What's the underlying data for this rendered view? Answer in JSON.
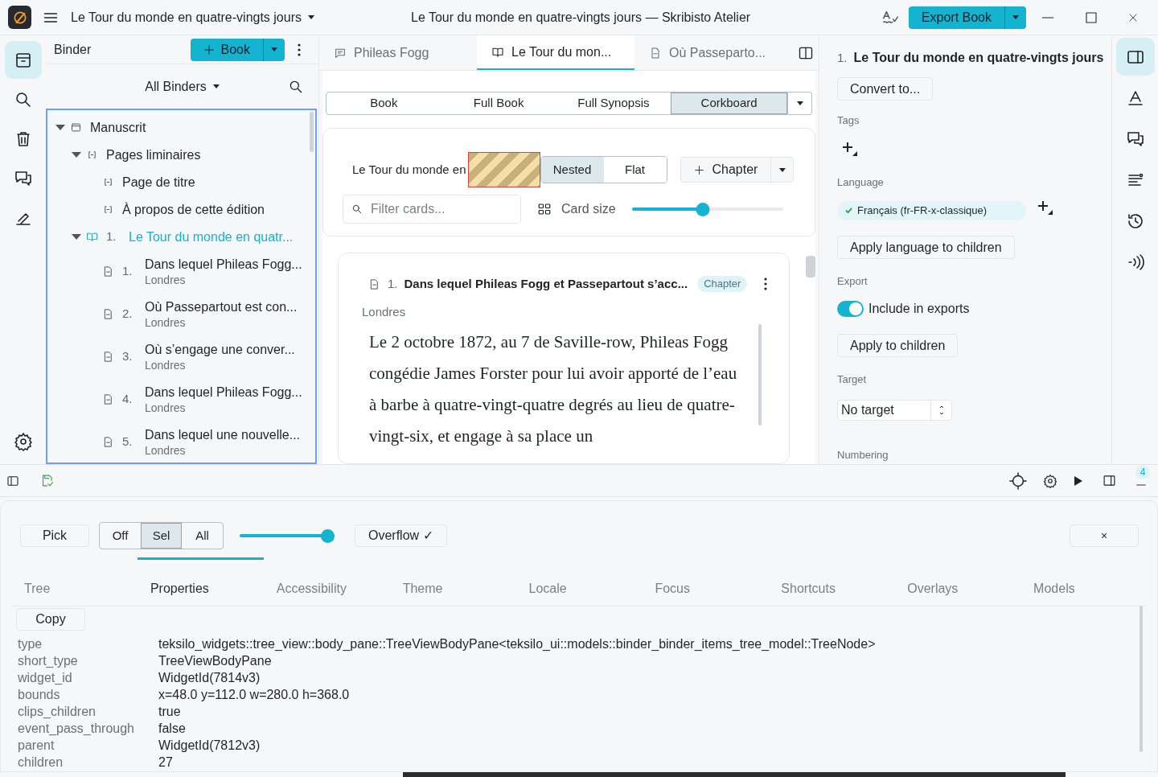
{
  "window": {
    "title": "Le Tour du monde en quatre-vingts jours — Skribisto Atelier"
  },
  "project_menu": {
    "label": "Le Tour du monde en quatre-vingts jours"
  },
  "export_button": {
    "label": "Export Book"
  },
  "left_rail": [
    {
      "kind": "binder",
      "selected": true
    },
    {
      "kind": "search",
      "selected": false
    },
    {
      "kind": "trash",
      "selected": false
    },
    {
      "kind": "comments",
      "selected": false
    },
    {
      "kind": "edit",
      "selected": false
    }
  ],
  "binder": {
    "title": "Binder",
    "add_button": "Book",
    "filter": "All Binders",
    "tree": [
      {
        "label": "Manuscrit",
        "kind": "folder",
        "expanded": true,
        "selected": false,
        "children": [
          {
            "label": "Pages liminaires",
            "kind": "section",
            "expanded": true,
            "selected": false,
            "children": [
              {
                "label": "Page de titre",
                "kind": "section",
                "selected": false
              },
              {
                "label": "À propos de cette édition",
                "kind": "section",
                "selected": false
              }
            ]
          },
          {
            "number": "1.",
            "label": "Le Tour du monde en quatr...",
            "kind": "book",
            "expanded": true,
            "selected": true,
            "children": [
              {
                "number": "1.",
                "label": "Dans lequel Phileas Fogg...",
                "subtitle": "Londres",
                "kind": "chapter",
                "selected": false
              },
              {
                "number": "2.",
                "label": "Où Passepartout est con...",
                "subtitle": "Londres",
                "kind": "chapter",
                "selected": false
              },
              {
                "number": "3.",
                "label": "Où s’engage une conver...",
                "subtitle": "Londres",
                "kind": "chapter",
                "selected": false
              },
              {
                "number": "4.",
                "label": "Dans lequel Phileas Fogg...",
                "subtitle": "Londres",
                "kind": "chapter",
                "selected": false
              },
              {
                "number": "5.",
                "label": "Dans lequel une nouvelle...",
                "subtitle": "Londres",
                "kind": "chapter",
                "selected": false
              }
            ]
          }
        ]
      }
    ]
  },
  "editor_tabs": [
    {
      "label": "Phileas Fogg",
      "kind": "comment",
      "selected": false
    },
    {
      "label": "Le Tour du mon...",
      "kind": "book",
      "selected": true
    },
    {
      "label": "Où Passeparto...",
      "kind": "doc",
      "selected": false
    }
  ],
  "view_modes": [
    {
      "label": "Book",
      "selected": false
    },
    {
      "label": "Full Book",
      "selected": false
    },
    {
      "label": "Full Synopsis",
      "selected": false
    },
    {
      "label": "Corkboard",
      "selected": true
    }
  ],
  "corkboard": {
    "breadcrumb": "Le Tour du monde en",
    "layout_options": [
      {
        "label": "Nested",
        "selected": true
      },
      {
        "label": "Flat",
        "selected": false
      }
    ],
    "add_button": "Chapter",
    "filter_placeholder": "Filter cards...",
    "card_size_label": "Card size",
    "card_size": {
      "level": 0.47
    },
    "cards": [
      {
        "number": "1.",
        "title": "Dans lequel Phileas Fogg et Passepartout s’acc...",
        "tag": "Chapter",
        "subtitle": "Londres",
        "body": "Le 2 octobre 1872, au 7 de Saville-row, Phileas Fogg congédie James Forster pour lui avoir apporté de l’eau à barbe à quatre-vingt-quatre degrés au lieu de quatre-vingt-six, et engage à sa place un"
      }
    ]
  },
  "inspector": {
    "number": "1.",
    "title": "Le Tour du monde en quatre-vingts jours",
    "convert_button": "Convert to...",
    "tags_label": "Tags",
    "language_label": "Language",
    "language": "Français (fr-FR-x-classique)",
    "apply_language_button": "Apply language to children",
    "export_label": "Export",
    "include_toggle": {
      "label": "Include in exports",
      "on": true
    },
    "apply_children_button": "Apply to children",
    "target_label": "Target",
    "target_value": "No target",
    "numbering_label": "Numbering"
  },
  "right_rail": [
    {
      "kind": "panel",
      "selected": true
    },
    {
      "kind": "text",
      "selected": false
    },
    {
      "kind": "comments",
      "selected": false
    },
    {
      "kind": "outline",
      "selected": false
    },
    {
      "kind": "history",
      "selected": false
    },
    {
      "kind": "audio",
      "selected": false
    }
  ],
  "notifications": {
    "count": "4"
  },
  "devtools": {
    "pick_button": "Pick",
    "modes": [
      {
        "label": "Off",
        "selected": false
      },
      {
        "label": "Sel",
        "selected": true
      },
      {
        "label": "All",
        "selected": false
      }
    ],
    "slider": {
      "level": 1
    },
    "overflow_button": "Overflow ✓",
    "close_button": "×",
    "tabs": [
      {
        "label": "Tree",
        "selected": false
      },
      {
        "label": "Properties",
        "selected": true
      },
      {
        "label": "Accessibility",
        "selected": false
      },
      {
        "label": "Theme",
        "selected": false
      },
      {
        "label": "Locale",
        "selected": false
      },
      {
        "label": "Focus",
        "selected": false
      },
      {
        "label": "Shortcuts",
        "selected": false
      },
      {
        "label": "Overlays",
        "selected": false
      },
      {
        "label": "Models",
        "selected": false
      }
    ],
    "copy_button": "Copy",
    "properties": [
      {
        "key": "type",
        "value": "teksilo_widgets::tree_view::body_pane::TreeViewBodyPane<teksilo_ui::models::binder_binder_items_tree_model::TreeNode>"
      },
      {
        "key": "short_type",
        "value": "TreeViewBodyPane"
      },
      {
        "key": "widget_id",
        "value": "WidgetId(7814v3)"
      },
      {
        "key": "bounds",
        "value": "x=48.0 y=112.0 w=280.0 h=368.0"
      },
      {
        "key": "clips_children",
        "value": "true"
      },
      {
        "key": "event_pass_through",
        "value": "false"
      },
      {
        "key": "parent",
        "value": "WidgetId(7812v3)"
      },
      {
        "key": "children",
        "value": "27"
      }
    ]
  }
}
